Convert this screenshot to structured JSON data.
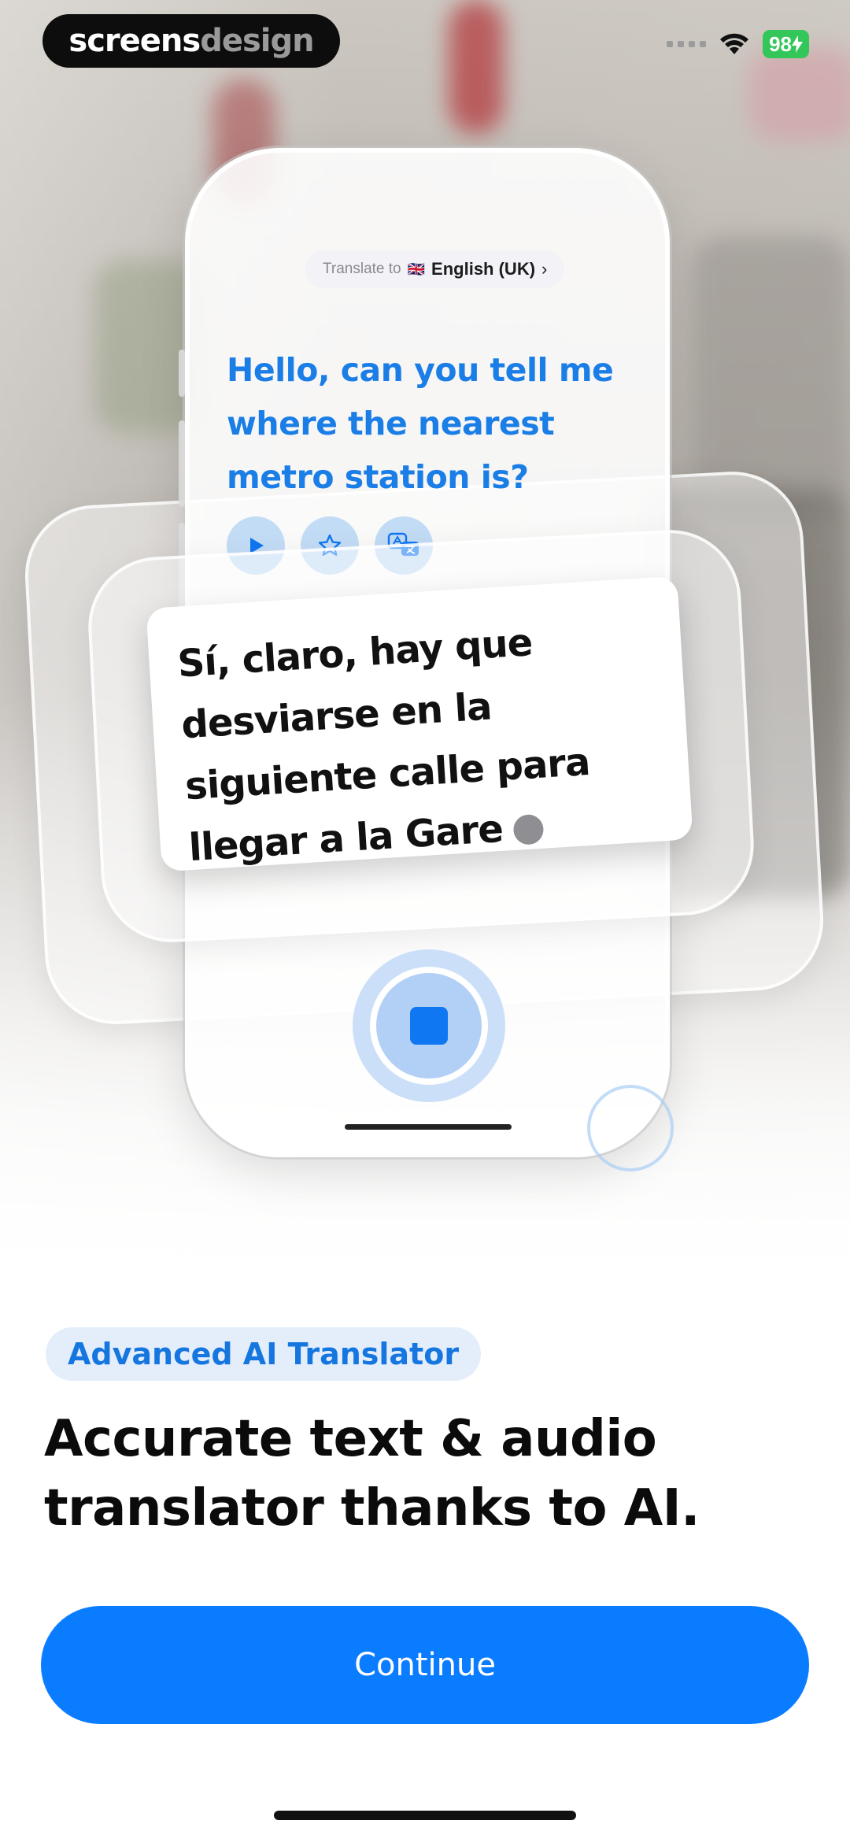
{
  "brand": {
    "part1": "screens",
    "part2": "design"
  },
  "status_bar": {
    "battery": "98"
  },
  "phone": {
    "translate_label": "Translate to",
    "flag": "🇬🇧",
    "language": "English (UK)",
    "chevron": "›",
    "source_text": "Hello, can you tell me where the nearest metro station is?",
    "translated_text": "Sí, claro, hay que desviarse en la siguiente calle para llegar a la Gare"
  },
  "onboarding": {
    "badge": "Advanced AI Translator",
    "headline": "Accurate text & audio translator thanks to AI.",
    "continue_label": "Continue"
  },
  "colors": {
    "accent": "#0A7CFF",
    "source_text": "#1A7EE6",
    "battery": "#33C759"
  }
}
